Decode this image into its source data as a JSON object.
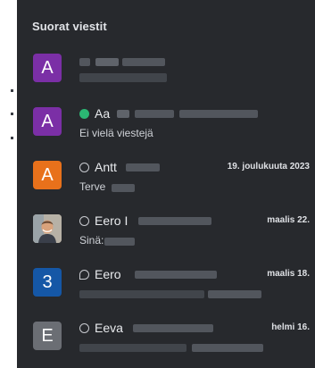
{
  "panel_title": "Suorat viestit",
  "colors": {
    "panel_bg": "#27292d",
    "online": "#2bb673"
  },
  "conversations": [
    {
      "avatar_letter": "A",
      "avatar_color": "#7b2fa6",
      "name": "",
      "date": "",
      "preview": ""
    },
    {
      "avatar_letter": "A",
      "avatar_color": "#7b2fa6",
      "status": "online",
      "name": "Aa",
      "date": "",
      "preview": "Ei vielä viestejä"
    },
    {
      "avatar_letter": "A",
      "avatar_color": "#e8711b",
      "status": "offline",
      "name": "Antt",
      "date": "19. joulukuuta 2023",
      "preview": "Terve "
    },
    {
      "avatar_letter": "",
      "avatar_kind": "photo",
      "status": "offline",
      "name": "Eero I",
      "date": "maalis 22.",
      "preview": "Sinä: "
    },
    {
      "avatar_letter": "3",
      "avatar_color": "#1557a6",
      "status": "away",
      "name": "Eero",
      "date": "maalis 18.",
      "preview": ""
    },
    {
      "avatar_letter": "E",
      "avatar_color": "#6b6e74",
      "status": "offline",
      "name": "Eeva",
      "date": "helmi 16.",
      "preview": ""
    }
  ]
}
